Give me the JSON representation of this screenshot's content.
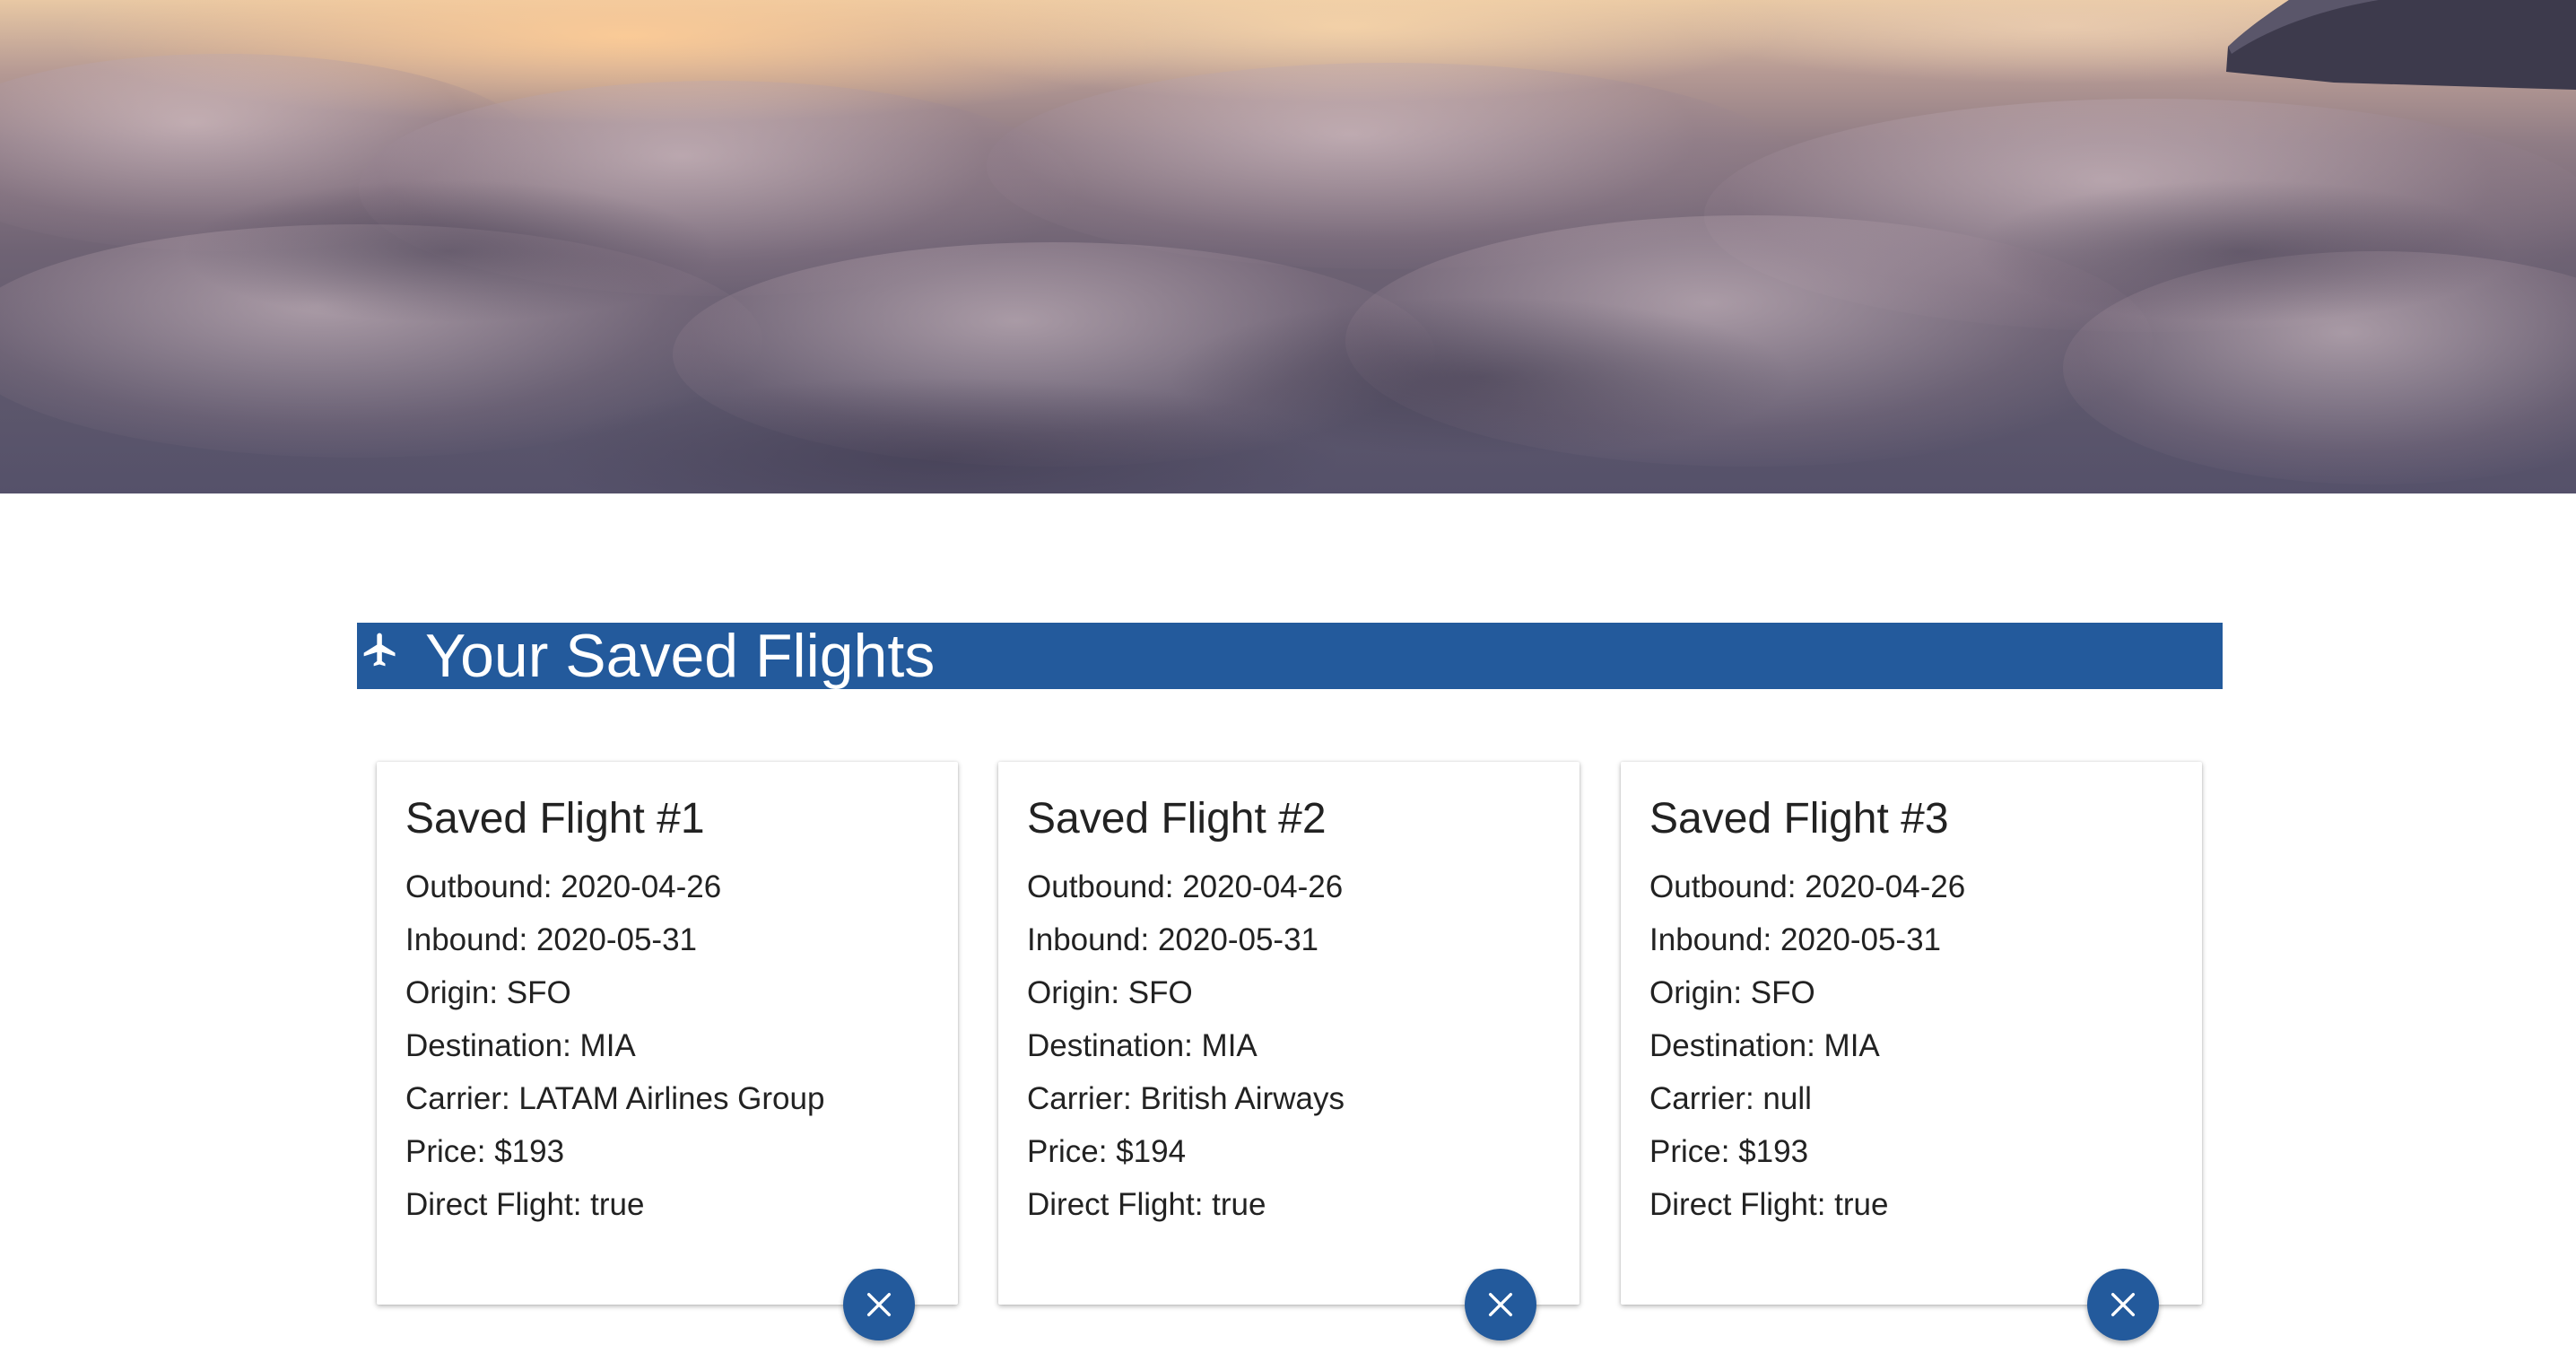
{
  "header": {
    "title": "Your Saved Flights",
    "icon": "airplane-icon",
    "color": "#235a9c"
  },
  "cards": [
    {
      "title": "Saved Flight #1",
      "outbound": "Outbound: 2020-04-26",
      "inbound": "Inbound: 2020-05-31",
      "origin": "Origin: SFO",
      "destination": "Destination: MIA",
      "carrier": "Carrier: LATAM Airlines Group",
      "price": "Price: $193",
      "direct": "Direct Flight: true",
      "remove_icon": "close-icon"
    },
    {
      "title": "Saved Flight #2",
      "outbound": "Outbound: 2020-04-26",
      "inbound": "Inbound: 2020-05-31",
      "origin": "Origin: SFO",
      "destination": "Destination: MIA",
      "carrier": "Carrier: British Airways",
      "price": "Price: $194",
      "direct": "Direct Flight: true",
      "remove_icon": "close-icon"
    },
    {
      "title": "Saved Flight #3",
      "outbound": "Outbound: 2020-04-26",
      "inbound": "Inbound: 2020-05-31",
      "origin": "Origin: SFO",
      "destination": "Destination: MIA",
      "carrier": "Carrier: null",
      "price": "Price: $193",
      "direct": "Direct Flight: true",
      "remove_icon": "close-icon"
    }
  ],
  "colors": {
    "accent": "#235a9c",
    "text": "#222222",
    "background": "#ffffff"
  }
}
